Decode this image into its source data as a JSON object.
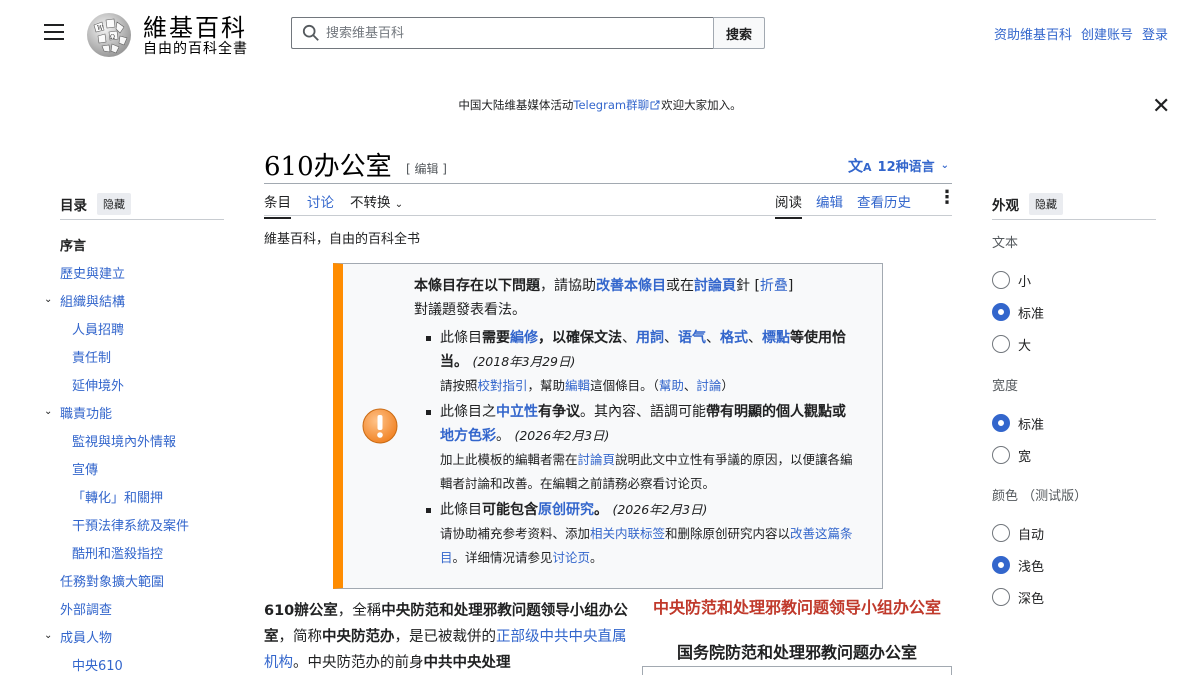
{
  "header": {
    "wordmark": "維基百科",
    "tagline": "自由的百科全書",
    "search_placeholder": "搜索维基百科",
    "search_button": "搜索",
    "user_links": [
      "资助维基百科",
      "创建账号",
      "登录"
    ]
  },
  "notice": {
    "prefix": "中国大陆维基媒体活动",
    "link": "Telegram群聊",
    "suffix": "欢迎大家加入。"
  },
  "page": {
    "title": "610办公室",
    "edit_link": "[ 编辑 ]",
    "languages": "12种语言",
    "tabs_left": [
      "条目",
      "讨论",
      "不转换"
    ],
    "tabs_right": [
      "阅读",
      "编辑",
      "查看历史"
    ],
    "from": "維基百科，自由的百科全书"
  },
  "toc": {
    "heading": "目录",
    "hide": "隐藏",
    "items": [
      {
        "label": "序言",
        "level": 1,
        "current": true
      },
      {
        "label": "歷史與建立",
        "level": 1
      },
      {
        "label": "組織與結構",
        "level": 1,
        "expandable": true
      },
      {
        "label": "人員招聘",
        "level": 2
      },
      {
        "label": "責任制",
        "level": 2
      },
      {
        "label": "延伸境外",
        "level": 2
      },
      {
        "label": "職責功能",
        "level": 1,
        "expandable": true
      },
      {
        "label": "監視與境內外情報",
        "level": 2
      },
      {
        "label": "宣傳",
        "level": 2
      },
      {
        "label": "「轉化」和關押",
        "level": 2
      },
      {
        "label": "干預法律系統及案件",
        "level": 2
      },
      {
        "label": "酷刑和濫殺指控",
        "level": 2
      },
      {
        "label": "任務對象擴大範圍",
        "level": 1
      },
      {
        "label": "外部調查",
        "level": 1
      },
      {
        "label": "成員人物",
        "level": 1,
        "expandable": true
      },
      {
        "label": "中央610",
        "level": 2
      }
    ]
  },
  "appearance": {
    "heading": "外观",
    "hide": "隐藏",
    "text_label": "文本",
    "text_options": [
      "小",
      "标准",
      "大"
    ],
    "text_selected": "标准",
    "width_label": "宽度",
    "width_options": [
      "标准",
      "宽"
    ],
    "width_selected": "标准",
    "color_label": "颜色 （测试版）",
    "color_options": [
      "自动",
      "浅色",
      "深色"
    ],
    "color_selected": "浅色"
  },
  "ambox": {
    "intro_bold": "本條目存在以下問題",
    "intro_1": "，請協助",
    "intro_link1": "改善本條目",
    "intro_2": "或在",
    "intro_link2": "討論頁",
    "intro_3": "針",
    "fold": "折叠",
    "intro_4": "對議題發表看法。",
    "issue1_a": "此條目",
    "issue1_b": "需要",
    "issue1_link1": "編修",
    "issue1_c": "，以確保文法",
    "issue1_sep1": "、",
    "issue1_link2": "用詞",
    "issue1_sep2": "、",
    "issue1_link3": "语气",
    "issue1_sep3": "、",
    "issue1_link4": "格式",
    "issue1_sep4": "、",
    "issue1_link5": "標點",
    "issue1_d": "等使用恰当。",
    "issue1_date": "(2018年3月29日)",
    "issue1_note_a": "請按照",
    "issue1_note_link1": "校對指引",
    "issue1_note_b": "，幫助",
    "issue1_note_link2": "編輯",
    "issue1_note_c": "這個條目。（",
    "issue1_note_link3": "幫助",
    "issue1_note_d": "、",
    "issue1_note_link4": "討論",
    "issue1_note_e": "）",
    "issue2_a": "此條目之",
    "issue2_link1": "中立性",
    "issue2_b": "有争议",
    "issue2_c": "。其內容、語調可能",
    "issue2_d": "帶有明顯的個人觀點或",
    "issue2_link2": "地方色彩",
    "issue2_e": "。",
    "issue2_date": "(2026年2月3日)",
    "issue2_note_a": "加上此模板的編輯者需在",
    "issue2_note_link": "討論頁",
    "issue2_note_b": "說明此文中立性有爭議的原因，以便讓各編輯者討論和改善。在編輯之前請務必察看讨论页。",
    "issue3_a": "此條目",
    "issue3_b": "可能包含",
    "issue3_link": "原创研究",
    "issue3_c": "。",
    "issue3_date": "(2026年2月3日)",
    "issue3_note_a": "请协助補充参考资料、添加",
    "issue3_note_link1": "相关内联标签",
    "issue3_note_b": "和删除原创研究内容以",
    "issue3_note_link2": "改善这篇条目",
    "issue3_note_c": "。详细情况请参见",
    "issue3_note_link3": "讨论页",
    "issue3_note_d": "。"
  },
  "lead": {
    "bold1": "610辦公室",
    "t1": "，全稱",
    "bold2": "中央防范和处理邪教问题领导小组办公室",
    "t2": "，简称",
    "bold3": "中央防范办",
    "t3": "，是已被裁併的",
    "link1": "正部级中共中央直属机构",
    "t4": "。中央防范办的前身",
    "bold4": "中共中央处理"
  },
  "infobox": {
    "title": "中央防范和处理邪教问题领导小组办公室",
    "subtitle": "国务院防范和处理邪教问题办公室"
  },
  "colors": {
    "link": "#3366cc",
    "ambox_stripe": "#ff8c00",
    "infobox_title": "#c0392b"
  }
}
